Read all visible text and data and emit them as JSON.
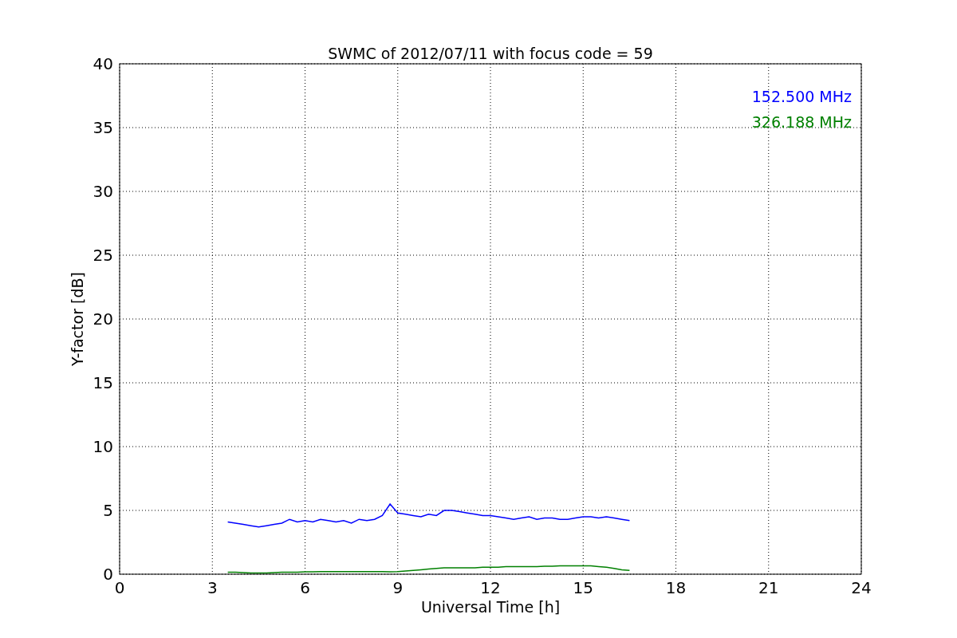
{
  "figure": {
    "chart_data": {
      "type": "line",
      "title": "SWMC of 2012/07/11 with focus code = 59",
      "xlabel": "Universal Time [h]",
      "ylabel": "Y-factor [dB]",
      "x": [
        3.5,
        3.75,
        4,
        4.25,
        4.5,
        4.75,
        5,
        5.25,
        5.5,
        5.75,
        6,
        6.25,
        6.5,
        6.75,
        7,
        7.25,
        7.5,
        7.75,
        8,
        8.25,
        8.5,
        8.75,
        9,
        9.25,
        9.5,
        9.75,
        10,
        10.25,
        10.5,
        10.75,
        11,
        11.25,
        11.5,
        11.75,
        12,
        12.25,
        12.5,
        12.75,
        13,
        13.25,
        13.5,
        13.75,
        14,
        14.25,
        14.5,
        14.75,
        15,
        15.25,
        15.5,
        15.75,
        16,
        16.25,
        16.5
      ],
      "series": [
        {
          "name": "152.500 MHz",
          "color": "#0000ff",
          "values": [
            4.1,
            4.0,
            3.9,
            3.8,
            3.7,
            3.8,
            3.9,
            4.0,
            4.3,
            4.1,
            4.2,
            4.1,
            4.3,
            4.2,
            4.1,
            4.2,
            4.0,
            4.3,
            4.2,
            4.3,
            4.6,
            5.5,
            4.8,
            4.7,
            4.6,
            4.5,
            4.7,
            4.6,
            5.0,
            5.0,
            4.9,
            4.8,
            4.7,
            4.6,
            4.6,
            4.5,
            4.4,
            4.3,
            4.4,
            4.5,
            4.3,
            4.4,
            4.4,
            4.3,
            4.3,
            4.4,
            4.5,
            4.5,
            4.4,
            4.5,
            4.4,
            4.3,
            4.2
          ]
        },
        {
          "name": "326.188 MHz",
          "color": "#008000",
          "values": [
            0.15,
            0.15,
            0.12,
            0.1,
            0.1,
            0.1,
            0.12,
            0.15,
            0.15,
            0.15,
            0.18,
            0.18,
            0.2,
            0.2,
            0.2,
            0.2,
            0.2,
            0.2,
            0.2,
            0.2,
            0.2,
            0.18,
            0.2,
            0.25,
            0.3,
            0.35,
            0.4,
            0.45,
            0.5,
            0.5,
            0.5,
            0.5,
            0.5,
            0.55,
            0.55,
            0.55,
            0.6,
            0.6,
            0.6,
            0.6,
            0.6,
            0.62,
            0.62,
            0.65,
            0.65,
            0.65,
            0.65,
            0.65,
            0.6,
            0.55,
            0.45,
            0.35,
            0.3
          ]
        }
      ],
      "xlim": [
        0,
        24
      ],
      "ylim": [
        0,
        40
      ],
      "xticks": [
        0,
        3,
        6,
        9,
        12,
        15,
        18,
        21,
        24
      ],
      "yticks": [
        0,
        5,
        10,
        15,
        20,
        25,
        30,
        35,
        40
      ],
      "grid": true
    }
  }
}
